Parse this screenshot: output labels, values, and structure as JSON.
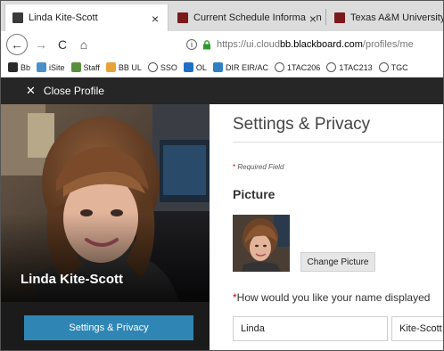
{
  "browser": {
    "tabs": [
      {
        "title": "Linda Kite-Scott",
        "close": "×"
      },
      {
        "title": "Current Schedule Information |",
        "close": "×"
      },
      {
        "title": "Texas A&M University-Ter"
      }
    ],
    "nav": {
      "back": "←",
      "forward": "→",
      "reload": "C",
      "home": "⌂"
    },
    "url": {
      "info": "i",
      "prefix": "https://ui.cloud",
      "domain": "bb.blackboard.com",
      "path": "/profiles/me"
    },
    "bookmarks": [
      {
        "label": "Bb",
        "icon": "blackboard-icon",
        "color": "#2b2b2b"
      },
      {
        "label": "iSite",
        "icon": "isite-icon",
        "color": "#4a90c8"
      },
      {
        "label": "Staff",
        "icon": "staff-icon",
        "color": "#5a8f3c"
      },
      {
        "label": "BB UL",
        "icon": "bb-ul-icon",
        "color": "#e8a23a"
      },
      {
        "label": "SSO",
        "icon": "globe-icon",
        "color": "#555"
      },
      {
        "label": "OL",
        "icon": "outlook-icon",
        "color": "#1f6fc4"
      },
      {
        "label": "DIR EIR/AC",
        "icon": "arrow-icon",
        "color": "#2f7fc1"
      },
      {
        "label": "1TAC206",
        "icon": "globe-icon",
        "color": "#555"
      },
      {
        "label": "1TAC213",
        "icon": "globe-icon",
        "color": "#555"
      },
      {
        "label": "TGC",
        "icon": "globe-icon",
        "color": "#555"
      }
    ]
  },
  "profile_bar": {
    "close_label": "Close Profile",
    "close_icon": "close-icon"
  },
  "sidebar": {
    "name": "Linda Kite-Scott",
    "settings_button": "Settings & Privacy"
  },
  "main": {
    "title": "Settings & Privacy",
    "required_star": "*",
    "required_note": "Required Field",
    "picture_heading": "Picture",
    "change_picture_button": "Change Picture",
    "name_question_star": "*",
    "name_question": "How would you like your name displayed",
    "first_name": "Linda",
    "last_name": "Kite-Scott"
  },
  "colors": {
    "accent": "#2f86b5",
    "header_dark": "#262626",
    "required": "#cc0000"
  }
}
